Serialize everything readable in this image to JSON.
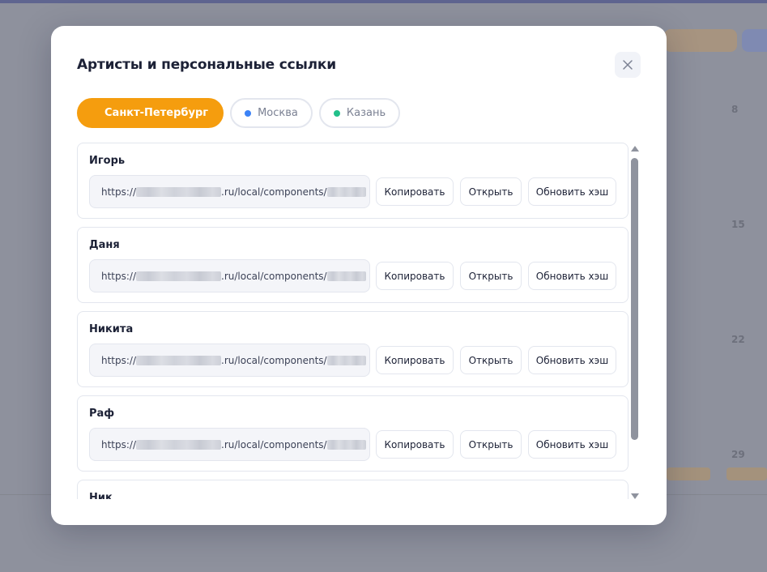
{
  "modal": {
    "title": "Артисты и персональные ссылки"
  },
  "cities": [
    {
      "label": "Санкт-Петербург",
      "active": true,
      "dot_color": null
    },
    {
      "label": "Москва",
      "active": false,
      "dot_color": "#3b82f6"
    },
    {
      "label": "Казань",
      "active": false,
      "dot_color": "#22c08a"
    }
  ],
  "artists": [
    {
      "name": "Игорь",
      "link_prefix": "https://",
      "link_middle": ".ru/local/components/"
    },
    {
      "name": "Даня",
      "link_prefix": "https://",
      "link_middle": ".ru/local/components/"
    },
    {
      "name": "Никита",
      "link_prefix": "https://",
      "link_middle": ".ru/local/components/"
    },
    {
      "name": "Раф",
      "link_prefix": "https://",
      "link_middle": ".ru/local/components/"
    },
    {
      "name": "Ник",
      "link_prefix": "https://",
      "link_middle": ".ru/local/components/"
    }
  ],
  "buttons": {
    "copy": "Копировать",
    "open": "Открыть",
    "refresh_hash": "Обновить хэш"
  },
  "background": {
    "numbers": [
      "8",
      "15",
      "22",
      "29"
    ]
  },
  "colors": {
    "accent": "#f59d0e",
    "text": "#1c2136"
  }
}
